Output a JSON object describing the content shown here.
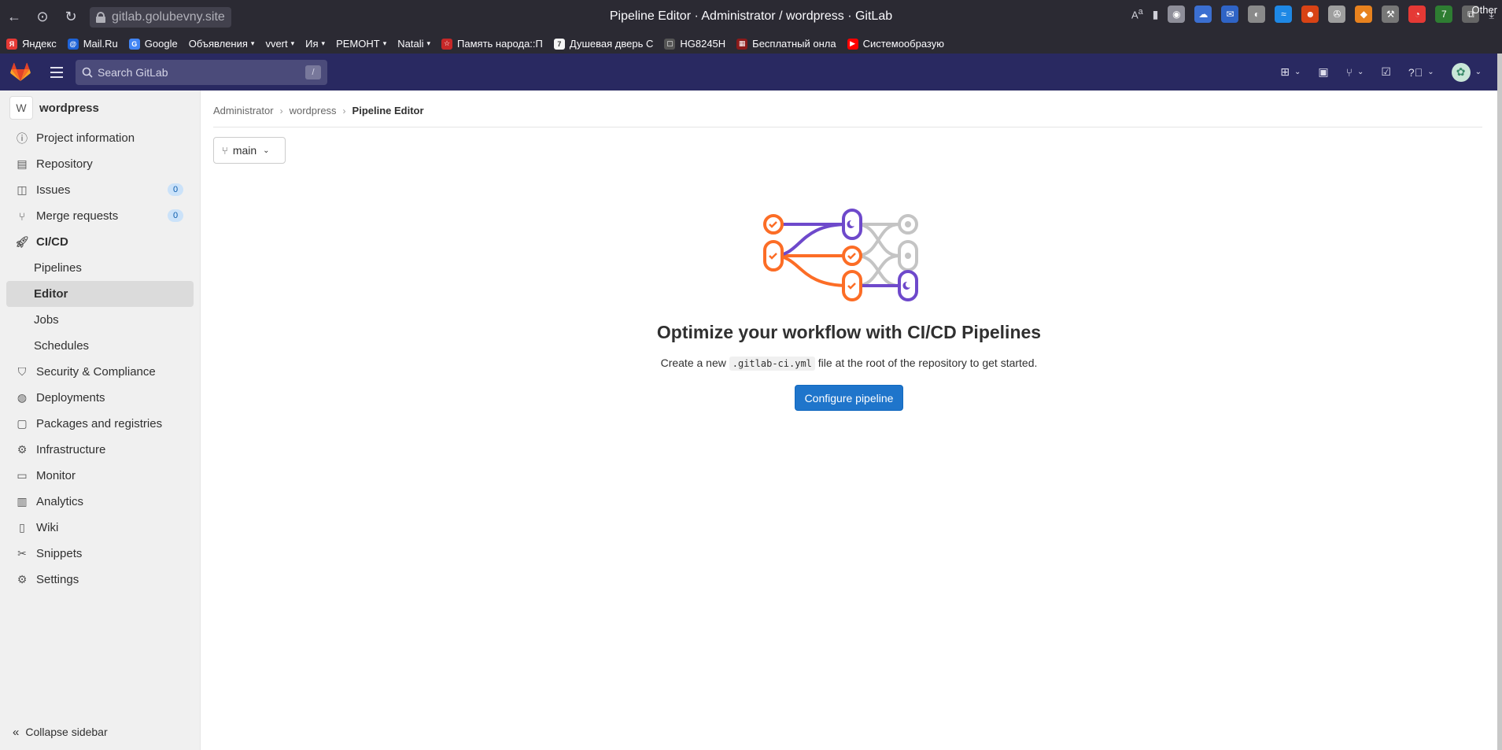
{
  "browser": {
    "url": "gitlab.golubevny.site",
    "window_title": "Pipeline Editor · Administrator / wordpress · GitLab",
    "bookmarks": [
      {
        "label": "Яндекс",
        "color": "#e53935",
        "glyph": "Я",
        "dropdown": false
      },
      {
        "label": "Mail.Ru",
        "color": "#1e63d8",
        "glyph": "@",
        "dropdown": false
      },
      {
        "label": "Google",
        "color": "#4285f4",
        "glyph": "G",
        "dropdown": false
      },
      {
        "label": "Объявления",
        "color": "",
        "glyph": "",
        "dropdown": true
      },
      {
        "label": "vvert",
        "color": "",
        "glyph": "",
        "dropdown": true
      },
      {
        "label": "Ия",
        "color": "",
        "glyph": "",
        "dropdown": true
      },
      {
        "label": "РЕМОНТ",
        "color": "",
        "glyph": "",
        "dropdown": true
      },
      {
        "label": "Natali",
        "color": "",
        "glyph": "",
        "dropdown": true
      },
      {
        "label": "Память народа::П",
        "color": "#c62828",
        "glyph": "☆",
        "dropdown": false
      },
      {
        "label": "Душевая дверь С",
        "color": "#f5f5f5",
        "glyph": "7",
        "dropdown": false
      },
      {
        "label": "HG8245H",
        "color": "#555555",
        "glyph": "▢",
        "dropdown": false
      },
      {
        "label": "Бесплатный онла",
        "color": "#8b1a1a",
        "glyph": "▦",
        "dropdown": false
      },
      {
        "label": "Системообразую",
        "color": "#ff0000",
        "glyph": "▶",
        "dropdown": false
      }
    ],
    "bookmarks_other": "Other"
  },
  "header": {
    "search_placeholder": "Search GitLab",
    "search_shortcut": "/"
  },
  "sidebar": {
    "project_avatar": "W",
    "project_name": "wordpress",
    "items": [
      {
        "label": "Project information",
        "icon": "info-icon"
      },
      {
        "label": "Repository",
        "icon": "book-icon"
      },
      {
        "label": "Issues",
        "icon": "issues-icon",
        "badge": "0"
      },
      {
        "label": "Merge requests",
        "icon": "merge-request-icon",
        "badge": "0"
      },
      {
        "label": "CI/CD",
        "icon": "rocket-icon"
      },
      {
        "label": "Security & Compliance",
        "icon": "shield-icon"
      },
      {
        "label": "Deployments",
        "icon": "deployments-icon"
      },
      {
        "label": "Packages and registries",
        "icon": "package-icon"
      },
      {
        "label": "Infrastructure",
        "icon": "cloud-gear-icon"
      },
      {
        "label": "Monitor",
        "icon": "monitor-icon"
      },
      {
        "label": "Analytics",
        "icon": "chart-icon"
      },
      {
        "label": "Wiki",
        "icon": "wiki-icon"
      },
      {
        "label": "Snippets",
        "icon": "scissors-icon"
      },
      {
        "label": "Settings",
        "icon": "gear-icon"
      }
    ],
    "cicd_sub": [
      "Pipelines",
      "Editor",
      "Jobs",
      "Schedules"
    ],
    "collapse_label": "Collapse sidebar"
  },
  "main": {
    "breadcrumb": [
      "Administrator",
      "wordpress",
      "Pipeline Editor"
    ],
    "branch": "main",
    "empty_title": "Optimize your workflow with CI/CD Pipelines",
    "empty_desc_before": "Create a new",
    "empty_desc_code": ".gitlab-ci.yml",
    "empty_desc_after": "file at the root of the repository to get started.",
    "configure_button": "Configure pipeline"
  },
  "colors": {
    "header_bg": "#292961",
    "primary_button": "#1f75cb",
    "orange": "#fc6d26",
    "purple": "#6e49cb",
    "gray": "#bfbfbf"
  }
}
